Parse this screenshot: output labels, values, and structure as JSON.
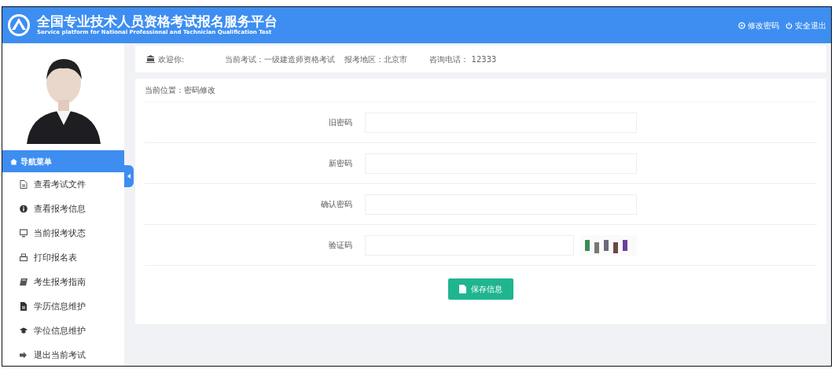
{
  "header": {
    "title": "全国专业技术人员资格考试报名服务平台",
    "subtitle": "Service platform for National Professional and Technician Qualification Test",
    "links": [
      {
        "label": "修改密码"
      },
      {
        "label": "安全退出"
      }
    ]
  },
  "sidebar": {
    "menu_title": "导航菜单",
    "items": [
      {
        "label": "查看考试文件"
      },
      {
        "label": "查看报考信息"
      },
      {
        "label": "当前报考状态"
      },
      {
        "label": "打印报名表"
      },
      {
        "label": "考生报考指南"
      },
      {
        "label": "学历信息维护"
      },
      {
        "label": "学位信息维护"
      },
      {
        "label": "退出当前考试"
      }
    ]
  },
  "info_bar": {
    "welcome": "欢迎你:",
    "exam": "当前考试：一级建造师资格考试",
    "region": "报考地区：北京市",
    "phone": "咨询电话： 12333"
  },
  "breadcrumb": "当前位置：密码修改",
  "form": {
    "fields": [
      {
        "label": "旧密码",
        "kind": "password"
      },
      {
        "label": "新密码",
        "kind": "password"
      },
      {
        "label": "确认密码",
        "kind": "password"
      },
      {
        "label": "验证码",
        "kind": "captcha"
      }
    ],
    "submit": "保存信息"
  }
}
